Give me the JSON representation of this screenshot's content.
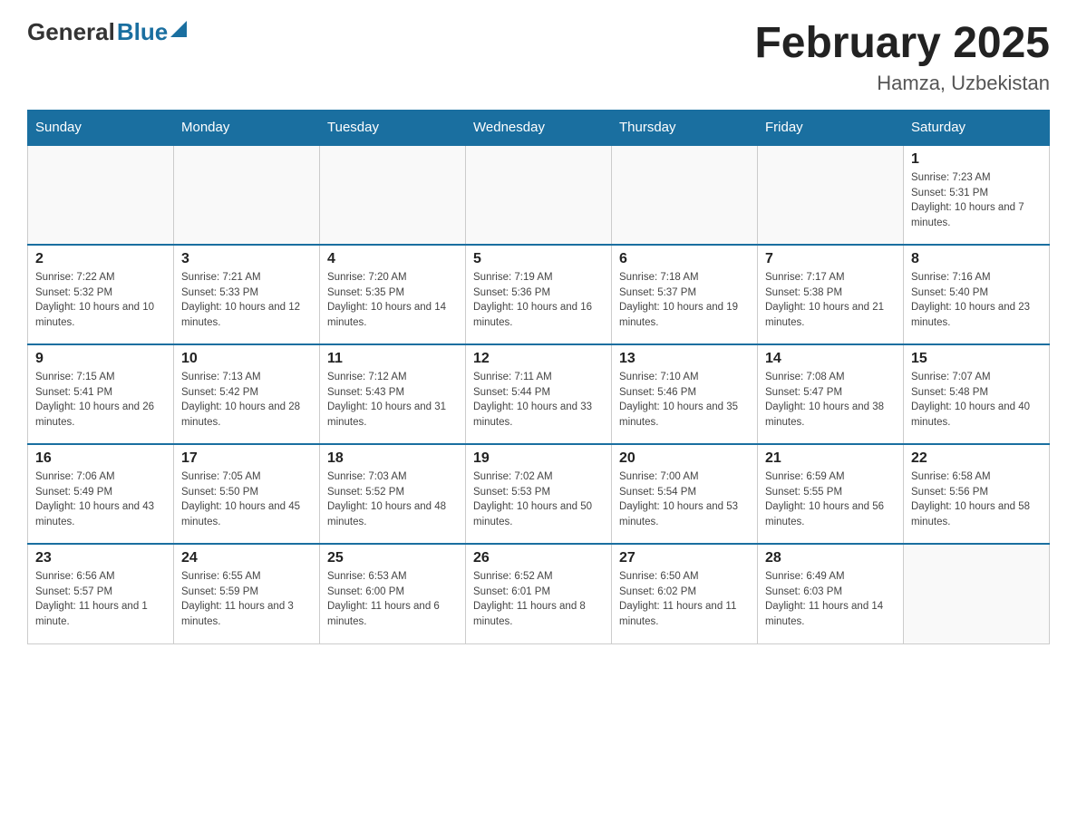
{
  "header": {
    "logo_general": "General",
    "logo_blue": "Blue",
    "title": "February 2025",
    "subtitle": "Hamza, Uzbekistan"
  },
  "weekdays": [
    "Sunday",
    "Monday",
    "Tuesday",
    "Wednesday",
    "Thursday",
    "Friday",
    "Saturday"
  ],
  "weeks": [
    {
      "days": [
        {
          "num": "",
          "info": ""
        },
        {
          "num": "",
          "info": ""
        },
        {
          "num": "",
          "info": ""
        },
        {
          "num": "",
          "info": ""
        },
        {
          "num": "",
          "info": ""
        },
        {
          "num": "",
          "info": ""
        },
        {
          "num": "1",
          "info": "Sunrise: 7:23 AM\nSunset: 5:31 PM\nDaylight: 10 hours and 7 minutes."
        }
      ]
    },
    {
      "days": [
        {
          "num": "2",
          "info": "Sunrise: 7:22 AM\nSunset: 5:32 PM\nDaylight: 10 hours and 10 minutes."
        },
        {
          "num": "3",
          "info": "Sunrise: 7:21 AM\nSunset: 5:33 PM\nDaylight: 10 hours and 12 minutes."
        },
        {
          "num": "4",
          "info": "Sunrise: 7:20 AM\nSunset: 5:35 PM\nDaylight: 10 hours and 14 minutes."
        },
        {
          "num": "5",
          "info": "Sunrise: 7:19 AM\nSunset: 5:36 PM\nDaylight: 10 hours and 16 minutes."
        },
        {
          "num": "6",
          "info": "Sunrise: 7:18 AM\nSunset: 5:37 PM\nDaylight: 10 hours and 19 minutes."
        },
        {
          "num": "7",
          "info": "Sunrise: 7:17 AM\nSunset: 5:38 PM\nDaylight: 10 hours and 21 minutes."
        },
        {
          "num": "8",
          "info": "Sunrise: 7:16 AM\nSunset: 5:40 PM\nDaylight: 10 hours and 23 minutes."
        }
      ]
    },
    {
      "days": [
        {
          "num": "9",
          "info": "Sunrise: 7:15 AM\nSunset: 5:41 PM\nDaylight: 10 hours and 26 minutes."
        },
        {
          "num": "10",
          "info": "Sunrise: 7:13 AM\nSunset: 5:42 PM\nDaylight: 10 hours and 28 minutes."
        },
        {
          "num": "11",
          "info": "Sunrise: 7:12 AM\nSunset: 5:43 PM\nDaylight: 10 hours and 31 minutes."
        },
        {
          "num": "12",
          "info": "Sunrise: 7:11 AM\nSunset: 5:44 PM\nDaylight: 10 hours and 33 minutes."
        },
        {
          "num": "13",
          "info": "Sunrise: 7:10 AM\nSunset: 5:46 PM\nDaylight: 10 hours and 35 minutes."
        },
        {
          "num": "14",
          "info": "Sunrise: 7:08 AM\nSunset: 5:47 PM\nDaylight: 10 hours and 38 minutes."
        },
        {
          "num": "15",
          "info": "Sunrise: 7:07 AM\nSunset: 5:48 PM\nDaylight: 10 hours and 40 minutes."
        }
      ]
    },
    {
      "days": [
        {
          "num": "16",
          "info": "Sunrise: 7:06 AM\nSunset: 5:49 PM\nDaylight: 10 hours and 43 minutes."
        },
        {
          "num": "17",
          "info": "Sunrise: 7:05 AM\nSunset: 5:50 PM\nDaylight: 10 hours and 45 minutes."
        },
        {
          "num": "18",
          "info": "Sunrise: 7:03 AM\nSunset: 5:52 PM\nDaylight: 10 hours and 48 minutes."
        },
        {
          "num": "19",
          "info": "Sunrise: 7:02 AM\nSunset: 5:53 PM\nDaylight: 10 hours and 50 minutes."
        },
        {
          "num": "20",
          "info": "Sunrise: 7:00 AM\nSunset: 5:54 PM\nDaylight: 10 hours and 53 minutes."
        },
        {
          "num": "21",
          "info": "Sunrise: 6:59 AM\nSunset: 5:55 PM\nDaylight: 10 hours and 56 minutes."
        },
        {
          "num": "22",
          "info": "Sunrise: 6:58 AM\nSunset: 5:56 PM\nDaylight: 10 hours and 58 minutes."
        }
      ]
    },
    {
      "days": [
        {
          "num": "23",
          "info": "Sunrise: 6:56 AM\nSunset: 5:57 PM\nDaylight: 11 hours and 1 minute."
        },
        {
          "num": "24",
          "info": "Sunrise: 6:55 AM\nSunset: 5:59 PM\nDaylight: 11 hours and 3 minutes."
        },
        {
          "num": "25",
          "info": "Sunrise: 6:53 AM\nSunset: 6:00 PM\nDaylight: 11 hours and 6 minutes."
        },
        {
          "num": "26",
          "info": "Sunrise: 6:52 AM\nSunset: 6:01 PM\nDaylight: 11 hours and 8 minutes."
        },
        {
          "num": "27",
          "info": "Sunrise: 6:50 AM\nSunset: 6:02 PM\nDaylight: 11 hours and 11 minutes."
        },
        {
          "num": "28",
          "info": "Sunrise: 6:49 AM\nSunset: 6:03 PM\nDaylight: 11 hours and 14 minutes."
        },
        {
          "num": "",
          "info": ""
        }
      ]
    }
  ]
}
